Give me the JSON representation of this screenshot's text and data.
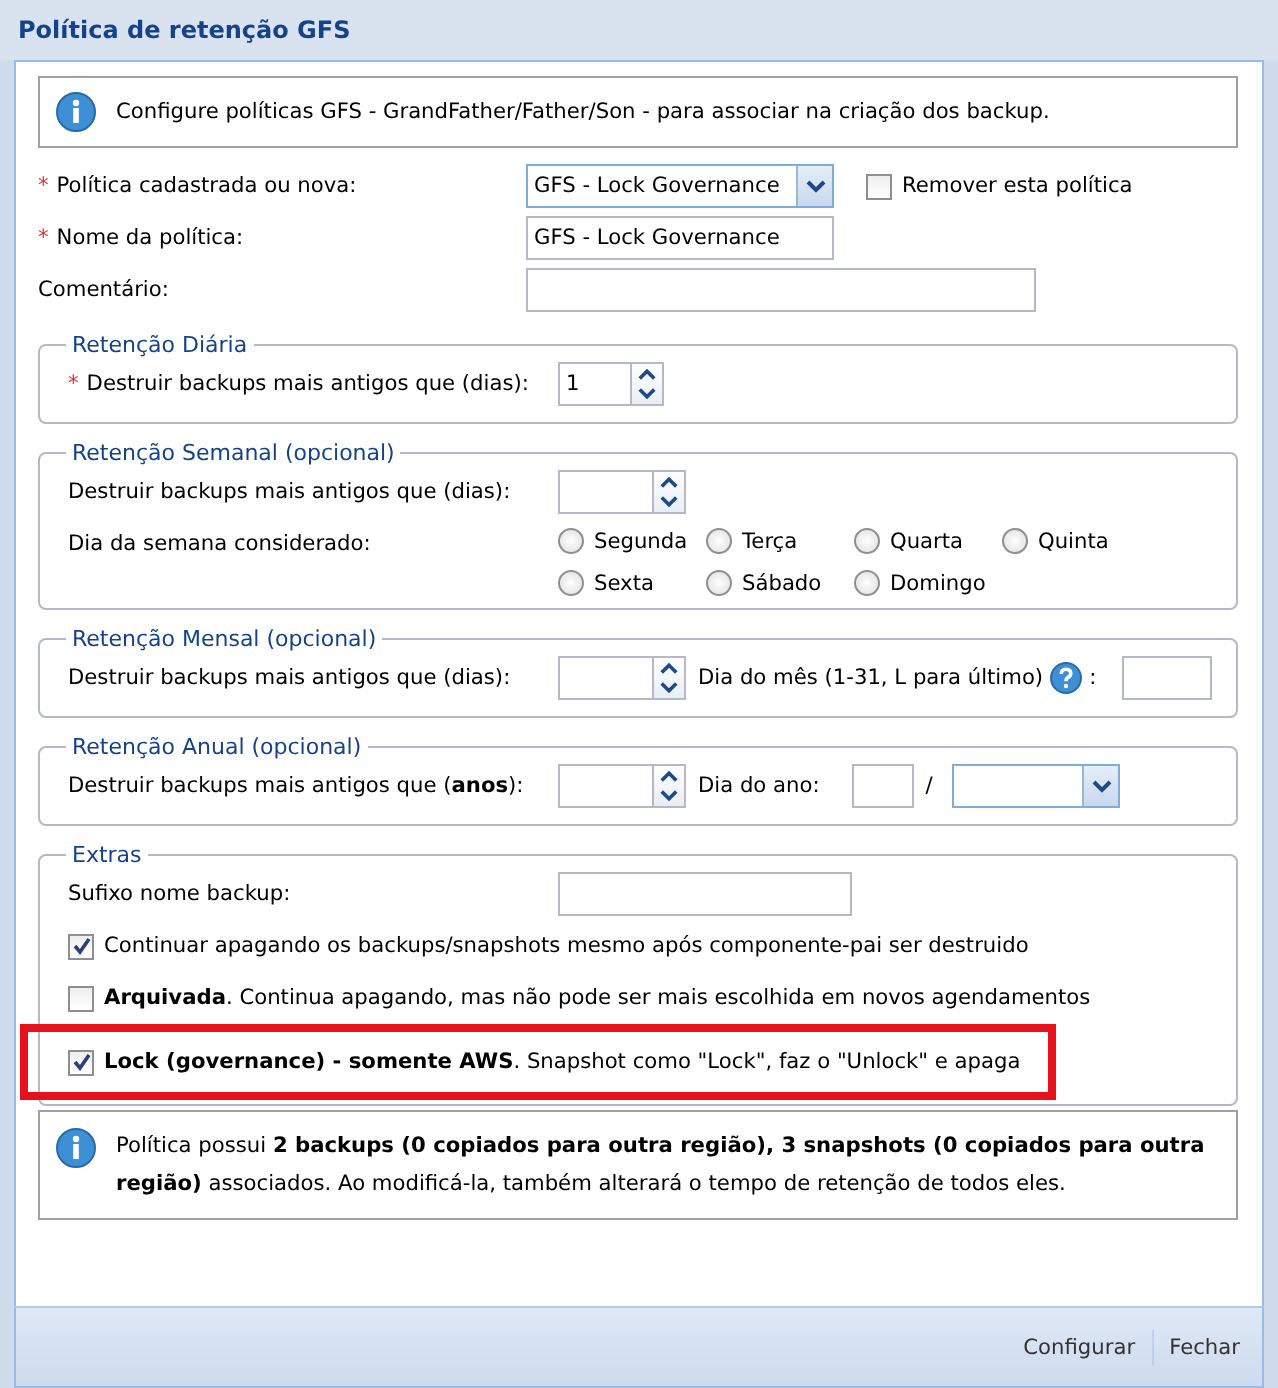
{
  "window": {
    "title": "Política de retenção GFS"
  },
  "info": "Configure políticas GFS - GrandFather/Father/Son - para associar na criação dos backup.",
  "policy": {
    "required_mark": "*",
    "label": "Política cadastrada ou nova:",
    "value": "GFS - Lock Governance",
    "remove": {
      "label": "Remover esta política",
      "checked": false
    }
  },
  "name": {
    "required_mark": "*",
    "label": "Nome da política:",
    "value": "GFS - Lock Governance"
  },
  "comment": {
    "label": "Comentário:"
  },
  "daily": {
    "legend": "Retenção Diária",
    "required_mark": "*",
    "label": "Destruir backups mais antigos que (dias):",
    "value": "1"
  },
  "weekly": {
    "legend": "Retenção Semanal (opcional)",
    "label": "Destruir backups mais antigos que (dias):",
    "day_label": "Dia da semana considerado:",
    "days": [
      {
        "label": "Segunda",
        "selected": false
      },
      {
        "label": "Terça",
        "selected": false
      },
      {
        "label": "Quarta",
        "selected": false
      },
      {
        "label": "Quinta",
        "selected": false
      },
      {
        "label": "Sexta",
        "selected": false
      },
      {
        "label": "Sábado",
        "selected": false
      },
      {
        "label": "Domingo",
        "selected": false
      }
    ]
  },
  "monthly": {
    "legend": "Retenção Mensal (opcional)",
    "label": "Destruir backups mais antigos que (dias):",
    "day_label": "Dia do mês (1-31, L para último)",
    "day_suffix": ":"
  },
  "yearly": {
    "legend": "Retenção Anual (opcional)",
    "label": "Destruir backups mais antigos que (**anos**):",
    "day_label": "Dia do ano:",
    "separator": "/"
  },
  "extras": {
    "legend": "Extras",
    "suffix_label": "Sufixo nome backup:",
    "options": [
      {
        "text": "Continuar apagando os backups/snapshots mesmo após componente-pai ser destruido",
        "checked": true,
        "highlighted": false
      },
      {
        "text": "**Arquivada**. Continua apagando, mas não pode ser mais escolhida em novos agendamentos",
        "checked": false,
        "highlighted": false
      },
      {
        "text": "**Lock (governance) - somente AWS**. Snapshot como \"Lock\", faz o \"Unlock\" e apaga",
        "checked": true,
        "highlighted": true
      }
    ]
  },
  "notice": "Política possui **2 backups (0 copiados para outra região), 3 snapshots (0 copiados para outra região)** associados. Ao modificá-la, também alterará o tempo de retenção de todos eles.",
  "buttons": [
    "Configurar",
    "Fechar"
  ]
}
